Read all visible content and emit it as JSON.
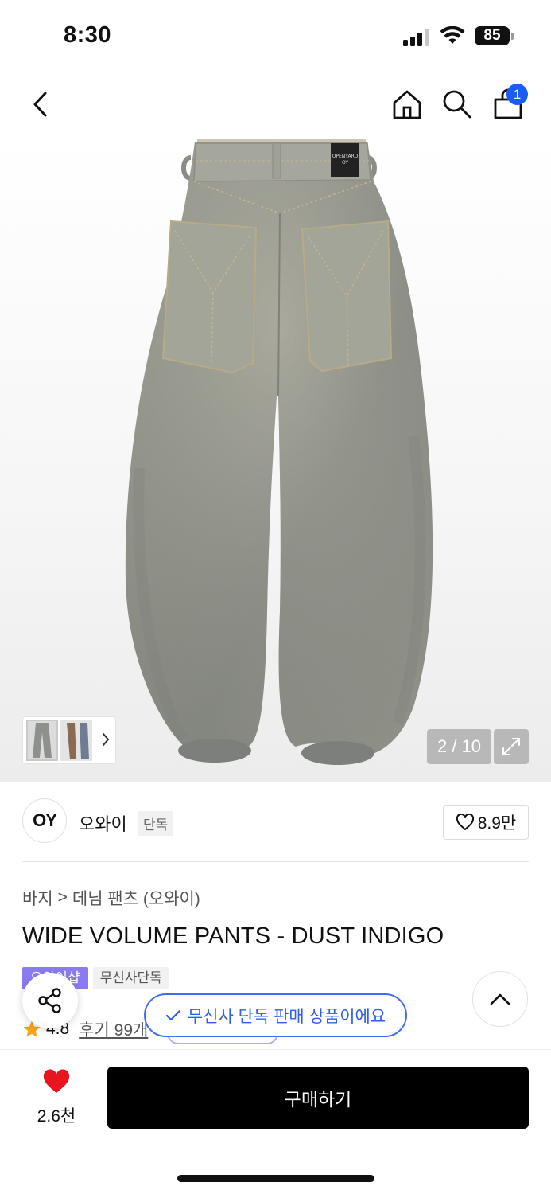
{
  "status_bar": {
    "time": "8:30",
    "battery": "85"
  },
  "nav": {
    "cart_count": "1"
  },
  "gallery": {
    "counter": "2 / 10",
    "pocket_label_line1": "OPENYARD",
    "pocket_label_line2": "OY"
  },
  "brand": {
    "logo_text": "OY",
    "name": "오와이",
    "tag": "단독",
    "likes": "8.9만"
  },
  "breadcrumb": {
    "category": "바지",
    "separator": ">",
    "subcategory": "데님 팬츠 (오와이)"
  },
  "product": {
    "title": "WIDE VOLUME PANTS - DUST INDIGO"
  },
  "badges": {
    "purple": "오와이샵",
    "gray": "무신사단독"
  },
  "rating": {
    "score": "4.8",
    "reviews": "후기 99개"
  },
  "toast": {
    "text": "무신사 단독 판매 상품이에요"
  },
  "bottom": {
    "wish_count": "2.6천",
    "buy_label": "구매하기"
  },
  "colors": {
    "accent_blue": "#1a5cf5",
    "heart_red": "#e8141e",
    "star_orange": "#f7a21b",
    "badge_purple": "#8a7cf0"
  }
}
